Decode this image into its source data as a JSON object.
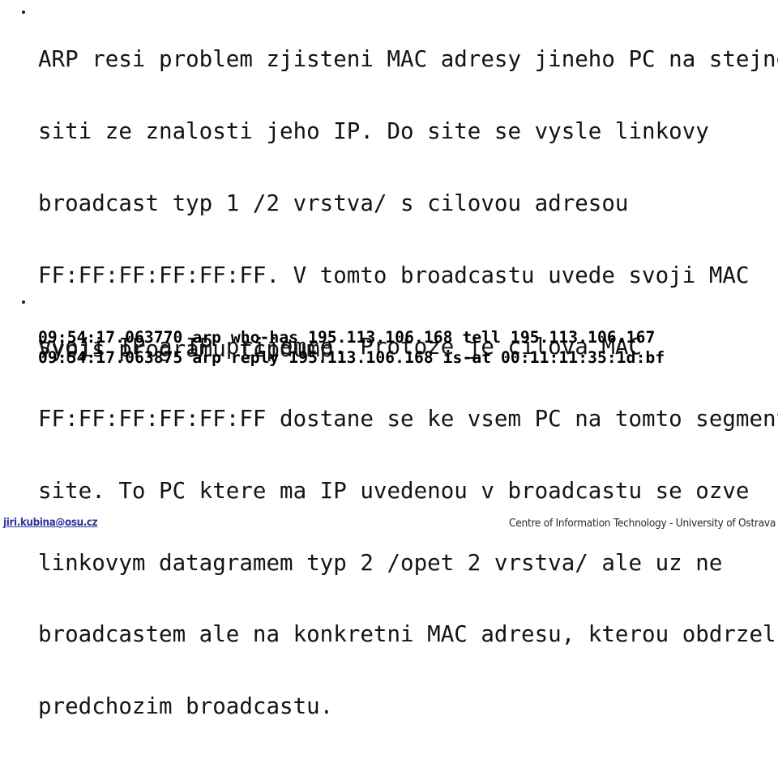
{
  "slide": {
    "background_color": "#ffffff",
    "text_color": "#141414"
  },
  "bullets": [
    {
      "id": "arp",
      "marker": "bullet-dot",
      "lines": [
        "ARP resi problem zjisteni MAC adresy jineho PC na stejne",
        "siti ze znalosti jeho IP. Do site se vysle linkovy",
        "broadcast typ 1 /2 vrstva/ s cilovou adresou",
        "FF:FF:FF:FF:FF:FF. V tomto broadcastu uvede svoji MAC",
        "svoji IP a IP prijemce. Protoze je cilova MAC",
        "FF:FF:FF:FF:FF:FF dostane se ke vsem PC na tomto segmentu",
        "site. To PC ktere ma IP uvedenou v broadcastu se ozve",
        "linkovym datagramem typ 2 /opet 2 vrstva/ ale uz ne",
        "broadcastem ale na konkretni MAC adresu, kterou obdrzel v",
        "predchozim broadcastu."
      ]
    },
    {
      "id": "vypis",
      "marker": "bullet-dot",
      "lines": [
        "Vypis programu tcpdump"
      ]
    }
  ],
  "tcpdump": {
    "lines": [
      "09:54:17.063770 arp who-has 195.113.106.168 tell 195.113.106.167",
      "09:54:17.063875 arp reply 195.113.106.168 is-at 00:11:11:35:1d:bf"
    ]
  },
  "footer": {
    "email": "jiri.kubina@osu.cz",
    "email_color": "#333399",
    "organization": "Centre of Information Technology - University of Ostrava"
  }
}
